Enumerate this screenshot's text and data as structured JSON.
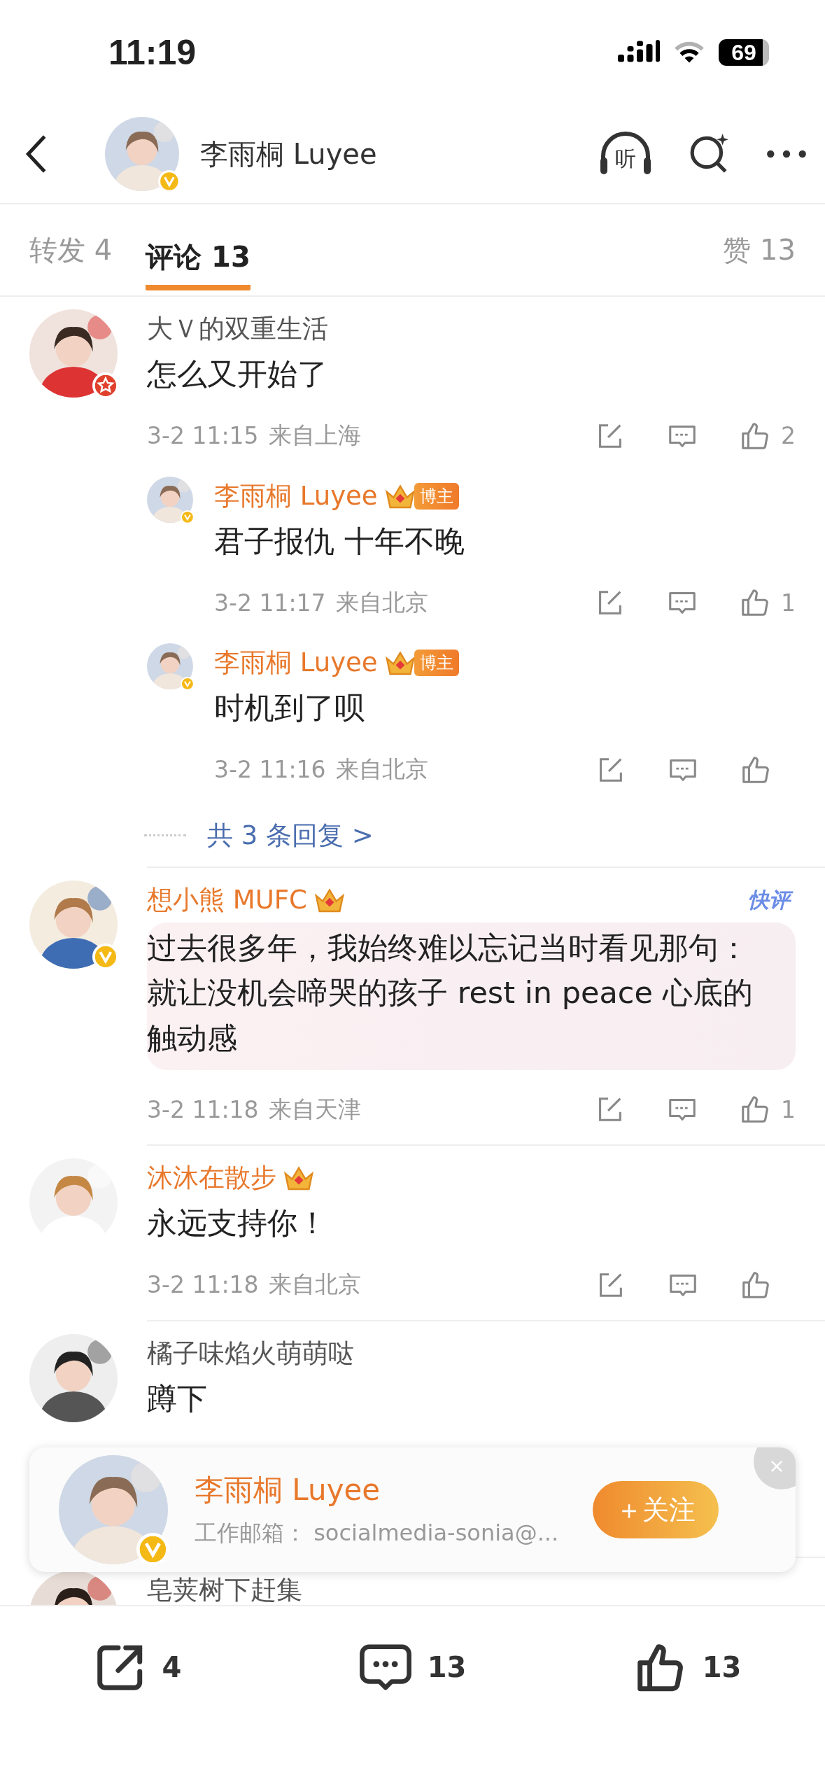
{
  "status_bar": {
    "time": "11:19",
    "battery": "69"
  },
  "header": {
    "name": "李雨桐 Luyee",
    "listen_label": "听"
  },
  "tabs": [
    {
      "label": "转发 4",
      "selected": false
    },
    {
      "label": "评论 13",
      "selected": true
    },
    {
      "label": "赞 13",
      "selected": false
    }
  ],
  "comments": [
    {
      "author": "大Ｖ的双重生活",
      "highlighted_name": false,
      "starred": true,
      "highlighted_text": false,
      "text": "怎么又开始了",
      "time": "3-2 11:15",
      "location": "来自上海",
      "likes": "2",
      "replies": [
        {
          "author": "李雨桐 Luyee",
          "highlighted_name": true,
          "verified": true,
          "badge": {
            "kind": "crown",
            "label": "博主"
          },
          "text": "君子报仇 十年不晚",
          "time": "3-2 11:17",
          "location": "来自北京",
          "likes": "1"
        },
        {
          "author": "李雨桐 Luyee",
          "highlighted_name": true,
          "verified": true,
          "badge": {
            "kind": "crown",
            "label": "博主"
          },
          "text": "时机到了呗",
          "time": "3-2 11:16",
          "location": "来自北京"
        }
      ],
      "more_replies": "共 3 条回复 >"
    },
    {
      "author": "想小熊 MUFC",
      "highlighted_name": true,
      "verified": true,
      "badge": {
        "kind": "crown"
      },
      "tag": "快评",
      "highlighted_text": true,
      "text": "过去很多年，我始终难以忘记当时看见那句：就让没机会啼哭的孩子 rest in peace 心底的触动感",
      "time": "3-2 11:18",
      "location": "来自天津",
      "likes": "1"
    },
    {
      "author": "沐沐在散步",
      "highlighted_name": true,
      "badge": {
        "kind": "crown"
      },
      "highlighted_text": false,
      "text": "永远支持你！",
      "time": "3-2 11:18",
      "location": "来自北京"
    },
    {
      "author": "橘子味焰火萌萌哒",
      "highlighted_name": false,
      "highlighted_text": false,
      "text": "蹲下"
    },
    {
      "author": "皂荚树下赶集",
      "highlighted_name": false
    }
  ],
  "follow_card": {
    "name": "李雨桐 Luyee",
    "subtitle": "工作邮箱：  socialmedia-sonia@...",
    "button": "＋关注"
  },
  "action_bar": [
    {
      "kind": "share",
      "count": "4"
    },
    {
      "kind": "comment",
      "count": "13"
    },
    {
      "kind": "like",
      "count": "13"
    }
  ]
}
